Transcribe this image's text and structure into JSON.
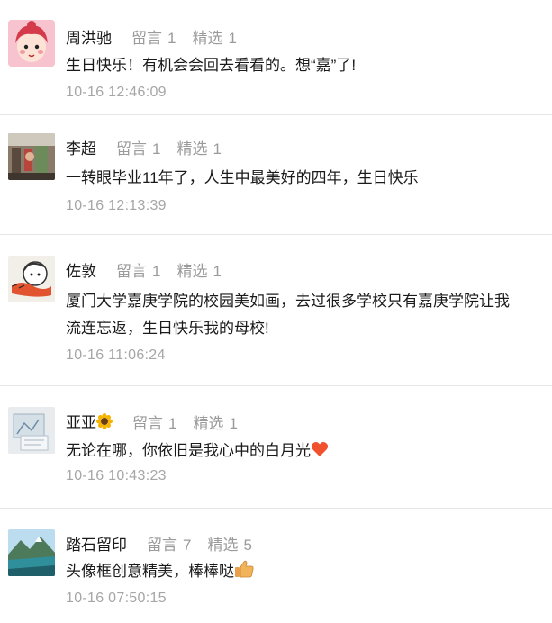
{
  "comments": [
    {
      "name": "周洪驰",
      "likes_label": "留言",
      "likes": "1",
      "selected_label": "精选",
      "selected": "1",
      "text": "生日快乐！有机会会回去看看的。想“嘉”了!",
      "time": "10-16 12:46:09",
      "avatar_icon": "cartoon-girl-avatar"
    },
    {
      "name": "李超",
      "likes_label": "留言",
      "likes": "1",
      "selected_label": "精选",
      "selected": "1",
      "text": "一转眼毕业11年了，人生中最美好的四年，生日快乐",
      "time": "10-16 12:13:39",
      "avatar_icon": "photo-avatar"
    },
    {
      "name": "佐敦",
      "likes_label": "留言",
      "likes": "1",
      "selected_label": "精选",
      "selected": "1",
      "text_line1": "厦门大学嘉庚学院的校园美如画，去过很多学校只有嘉庚学院让我",
      "text_line2": "流连忘返，生日快乐我的母校!",
      "time": "10-16 11:06:24",
      "avatar_icon": "cartoon-boy-avatar"
    },
    {
      "name": "亚亚",
      "name_emoji": "sunflower-icon",
      "likes_label": "留言",
      "likes": "1",
      "selected_label": "精选",
      "selected": "1",
      "text": "无论在哪，你依旧是我心中的白月光",
      "text_emoji": "heart-icon",
      "time": "10-16 10:43:23",
      "avatar_icon": "sketch-avatar"
    },
    {
      "name": "踏石留印",
      "likes_label": "留言",
      "likes": "7",
      "selected_label": "精选",
      "selected": "5",
      "text": "头像框创意精美，棒棒哒",
      "text_emoji": "thumbs-up-icon",
      "time": "10-16 07:50:15",
      "avatar_icon": "landscape-avatar"
    }
  ],
  "colors": {
    "name": "#1a1a1a",
    "stat": "#9b9b9b",
    "time": "#a6a6a6",
    "divider": "#e6e6e6"
  }
}
